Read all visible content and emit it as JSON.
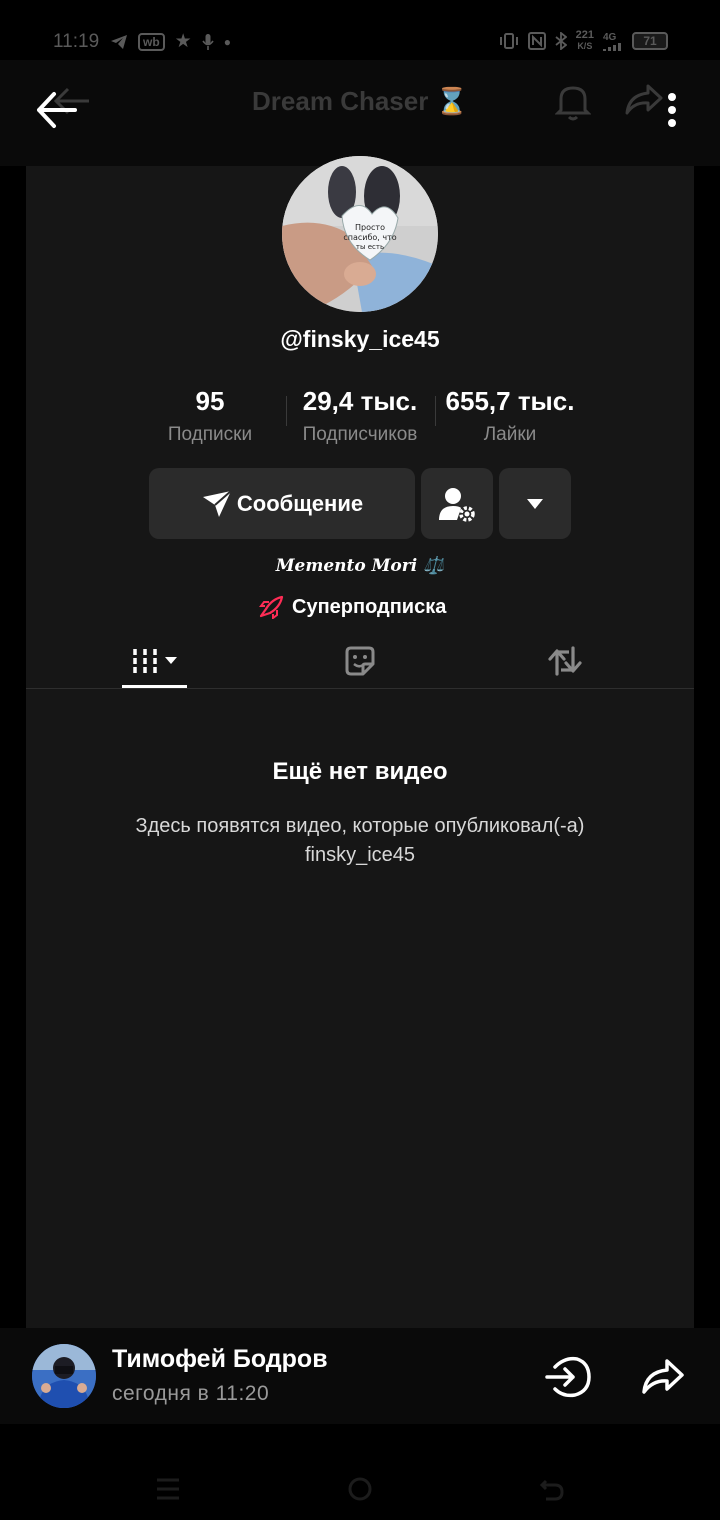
{
  "status_bar": {
    "time": "11:19",
    "net_speed_value": "221",
    "net_speed_unit": "K/S",
    "network": "4G",
    "battery": "71",
    "left_icons": [
      "telegram-icon",
      "wb-icon",
      "star-icon",
      "mic-icon",
      "dot-icon"
    ],
    "right_icons": [
      "vibrate-icon",
      "nfc-icon",
      "bluetooth-icon",
      "signal-icon",
      "battery-icon"
    ]
  },
  "header": {
    "title": "Dream Chaser ⌛"
  },
  "profile": {
    "username": "@finsky_ice45",
    "stats": [
      {
        "value": "95",
        "label": "Подписки"
      },
      {
        "value": "29,4 тыс.",
        "label": "Подписчиков"
      },
      {
        "value": "655,7 тыс.",
        "label": "Лайки"
      }
    ],
    "message_button": "Сообщение",
    "bio": "𝑴𝒆𝒎𝒆𝒏𝒕𝒐 𝑴𝒐𝒓𝒊 ⚖️",
    "super_subscription": "Суперподписка",
    "empty_title": "Ещё нет видео",
    "empty_desc": "Здесь появятся видео, которые опубликовал(-а) finsky_ice45"
  },
  "sender": {
    "name": "Тимофей Бодров",
    "time": "сегодня в 11:20"
  },
  "colors": {
    "panel": "#161616",
    "button": "#2b2b2b",
    "accent_red": "#fe2c55"
  }
}
